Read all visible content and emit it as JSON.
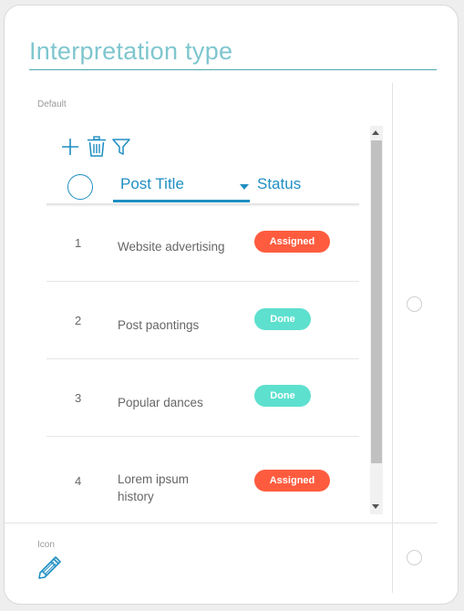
{
  "form": {
    "title": "Interpretation type",
    "default_label": "Default",
    "icon_label": "Icon"
  },
  "toolbar": {
    "icons": [
      "plus-icon",
      "trash-icon",
      "filter-icon"
    ]
  },
  "table": {
    "columns": [
      "Post Title",
      "Status"
    ],
    "sort_column": "Post Title",
    "rows": [
      {
        "num": "1",
        "title": "Website advertising",
        "status": "Assigned"
      },
      {
        "num": "2",
        "title": "Post paontings",
        "status": "Done"
      },
      {
        "num": "3",
        "title": "Popular dances",
        "status": "Done"
      },
      {
        "num": "4",
        "title": "Lorem ipsum history",
        "status": "Assigned"
      }
    ]
  },
  "colors": {
    "accent": "#1e8ec2",
    "assigned": "#ff5c3f",
    "done": "#5ee0cf",
    "title": "#7fc6cf"
  }
}
